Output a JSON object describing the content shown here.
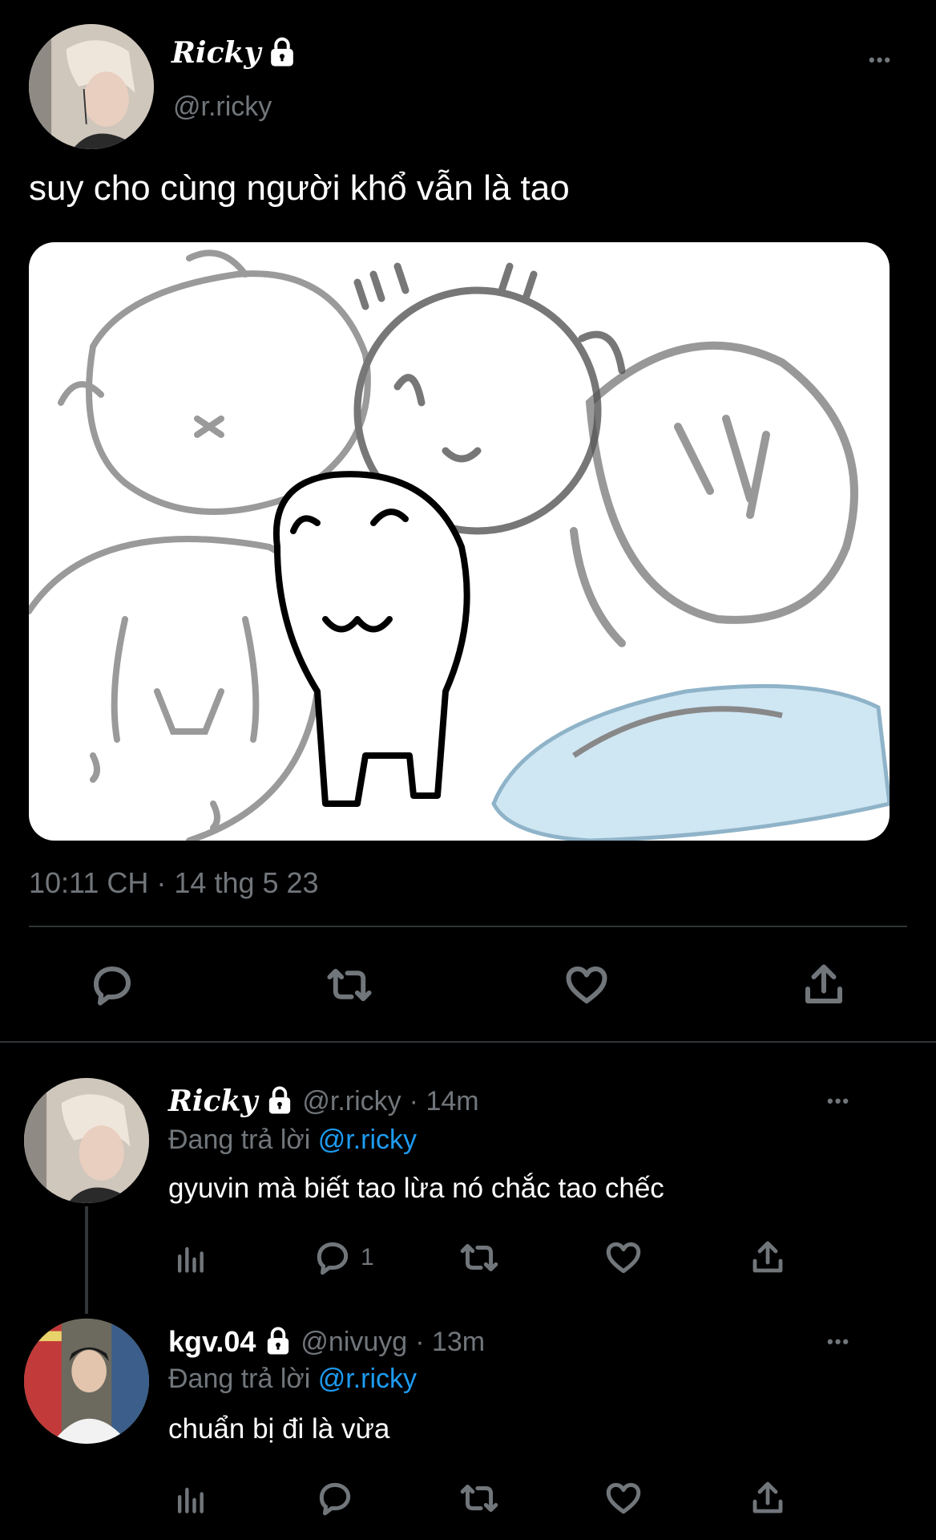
{
  "main_tweet": {
    "display_name": "Ricky",
    "handle": "@r.ricky",
    "text": "suy cho cùng người khổ vẫn là tao",
    "timestamp": "10:11 CH · 14 thg 5 23",
    "more_label": "•••",
    "actions": [
      "reply-icon",
      "retweet-icon",
      "like-icon",
      "share-icon"
    ]
  },
  "replies": [
    {
      "display_name": "Ricky",
      "handle": "@r.ricky",
      "time": "· 14m",
      "replying_prefix": "Đang trả lời",
      "replying_to": "@r.ricky",
      "text": "gyuvin mà biết tao lừa nó chắc tao chếc",
      "reply_count": "1",
      "more_label": "•••"
    },
    {
      "display_name": "kgv.04",
      "handle": "@nivuyg",
      "time": "· 13m",
      "replying_prefix": "Đang trả lời",
      "replying_to": "@r.ricky",
      "text": "chuẩn bị đi là vừa",
      "reply_count": "",
      "more_label": "•••"
    }
  ],
  "colors": {
    "background": "#000000",
    "text": "#e7e9ea",
    "muted": "#71767b",
    "link": "#1d9bf0",
    "divider": "#2f3336"
  }
}
